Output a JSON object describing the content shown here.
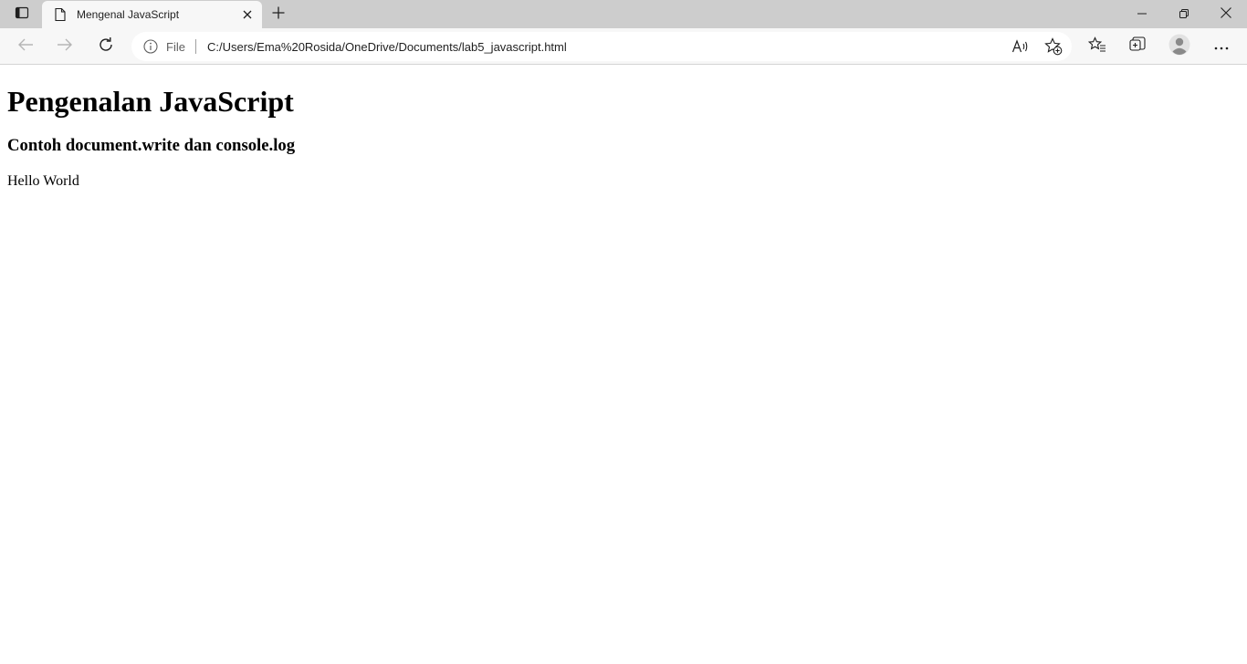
{
  "browser": {
    "tab": {
      "title": "Mengenal JavaScript"
    },
    "address_bar": {
      "scheme_label": "File",
      "url": "C:/Users/Ema%20Rosida/OneDrive/Documents/lab5_javascript.html"
    },
    "icons": {
      "tab_actions": "tab-actions-icon",
      "favicon": "page-icon",
      "close_tab": "close-icon",
      "new_tab": "plus-icon",
      "back": "arrow-left-icon",
      "forward": "arrow-right-icon",
      "refresh": "refresh-icon",
      "site_info": "info-icon",
      "read_aloud": "read-aloud-icon",
      "add_favorite": "star-add-icon",
      "favorites": "favorites-icon",
      "collections": "collections-icon",
      "profile": "avatar-icon",
      "more": "more-icon",
      "minimize": "minimize-icon",
      "restore": "restore-icon",
      "close_window": "close-window-icon"
    }
  },
  "page": {
    "heading": "Pengenalan JavaScript",
    "subheading": "Contoh document.write dan console.log",
    "output_text": "Hello World"
  }
}
